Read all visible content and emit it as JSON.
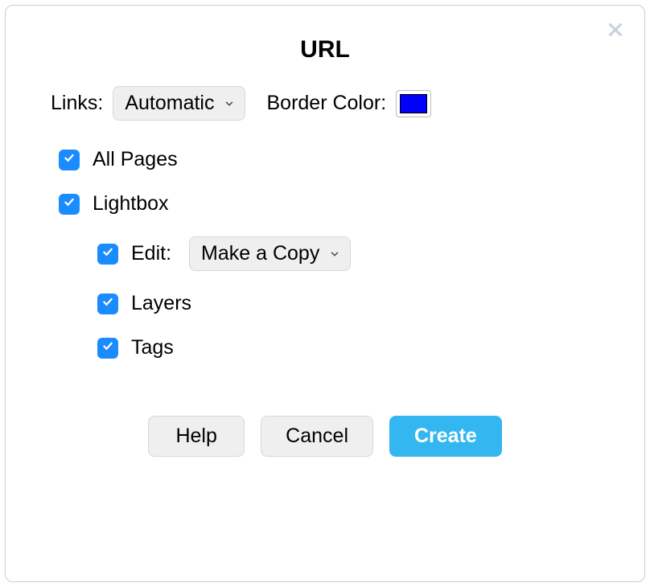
{
  "dialog": {
    "title": "URL",
    "links_label": "Links:",
    "links_value": "Automatic",
    "border_color_label": "Border Color:",
    "border_color_value": "#0000FF",
    "checkboxes": {
      "all_pages": {
        "label": "All Pages",
        "checked": true
      },
      "lightbox": {
        "label": "Lightbox",
        "checked": true
      },
      "edit": {
        "label": "Edit:",
        "checked": true,
        "value": "Make a Copy"
      },
      "layers": {
        "label": "Layers",
        "checked": true
      },
      "tags": {
        "label": "Tags",
        "checked": true
      }
    },
    "buttons": {
      "help": "Help",
      "cancel": "Cancel",
      "create": "Create"
    }
  }
}
